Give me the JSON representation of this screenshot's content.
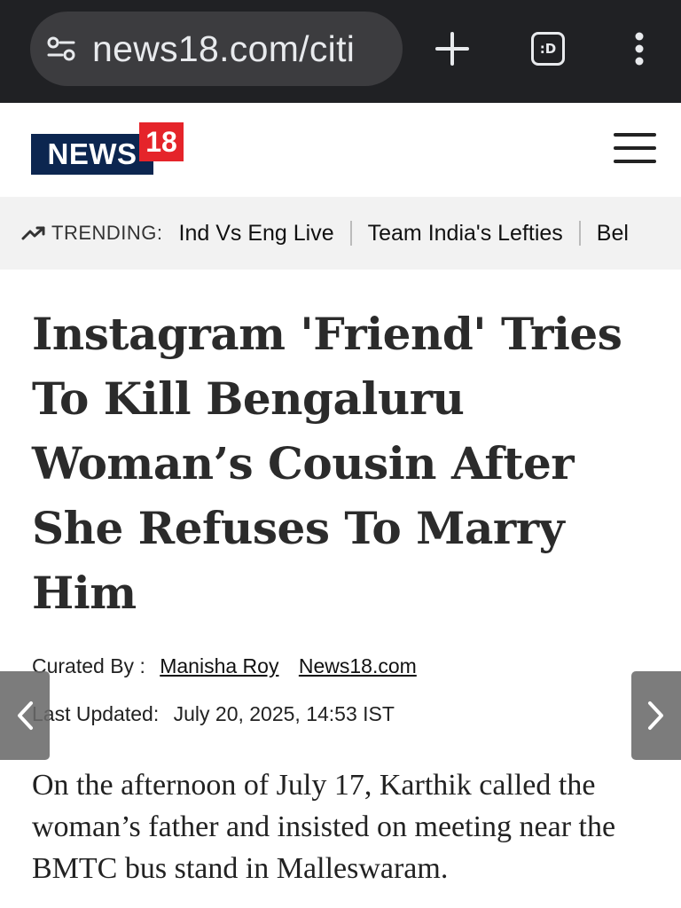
{
  "browser": {
    "url": "news18.com/citi",
    "icons": [
      "site-settings-icon",
      "plus-icon",
      "tabs-icon",
      "more-vert-icon"
    ],
    "tab_count_label": ":D"
  },
  "header": {
    "logo_news": "NEWS",
    "logo_18": "18",
    "brand_colors": {
      "navy": "#0c2650",
      "red": "#e5242a"
    }
  },
  "trending": {
    "label": "TRENDING:",
    "items": [
      "Ind Vs Eng Live",
      "Team India's Lefties",
      "Bel"
    ]
  },
  "article": {
    "headline": "Instagram 'Friend' Tries To Kill Bengaluru Woman’s Cousin After She Refuses To Marry Him",
    "curated_label": "Curated By :",
    "author": "Manisha Roy",
    "source": "News18.com",
    "updated_label": "Last Updated:",
    "updated_value": "July 20, 2025, 14:53 IST",
    "body": "On the afternoon of July 17, Karthik called the woman’s father and insisted on meeting near the BMTC bus stand in Malleswaram."
  }
}
